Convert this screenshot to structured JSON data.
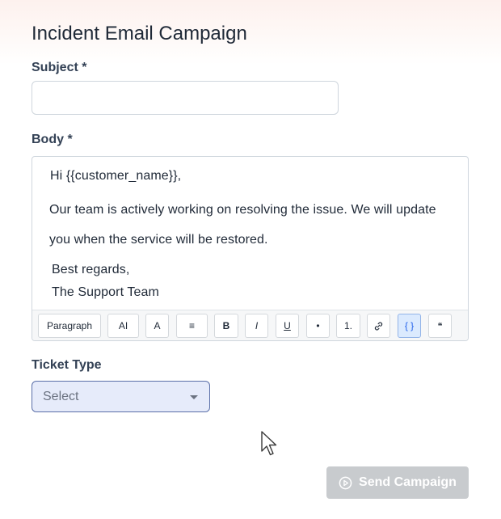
{
  "page": {
    "title": "Incident Email Campaign"
  },
  "subject": {
    "label": "Subject *",
    "value": "",
    "placeholder": ""
  },
  "body": {
    "label": "Body *",
    "lines": [
      "Hi {{customer_name}},",
      "Our team is actively working on resolving the issue. We will update",
      "you when the service will be restored.",
      "Best regards,",
      "The Support Team"
    ]
  },
  "toolbar": {
    "paragraph": "Paragraph",
    "ai": "AI",
    "font": "A",
    "align": "≡",
    "bold": "B",
    "italic": "I",
    "underline": "U",
    "bullet": "•",
    "numbered": "1.",
    "link_icon": "link-icon",
    "variable": "{ }",
    "quote": "❝"
  },
  "ticket_type": {
    "label": "Ticket Type",
    "selected": "Select"
  },
  "actions": {
    "send_label": "Send Campaign"
  }
}
